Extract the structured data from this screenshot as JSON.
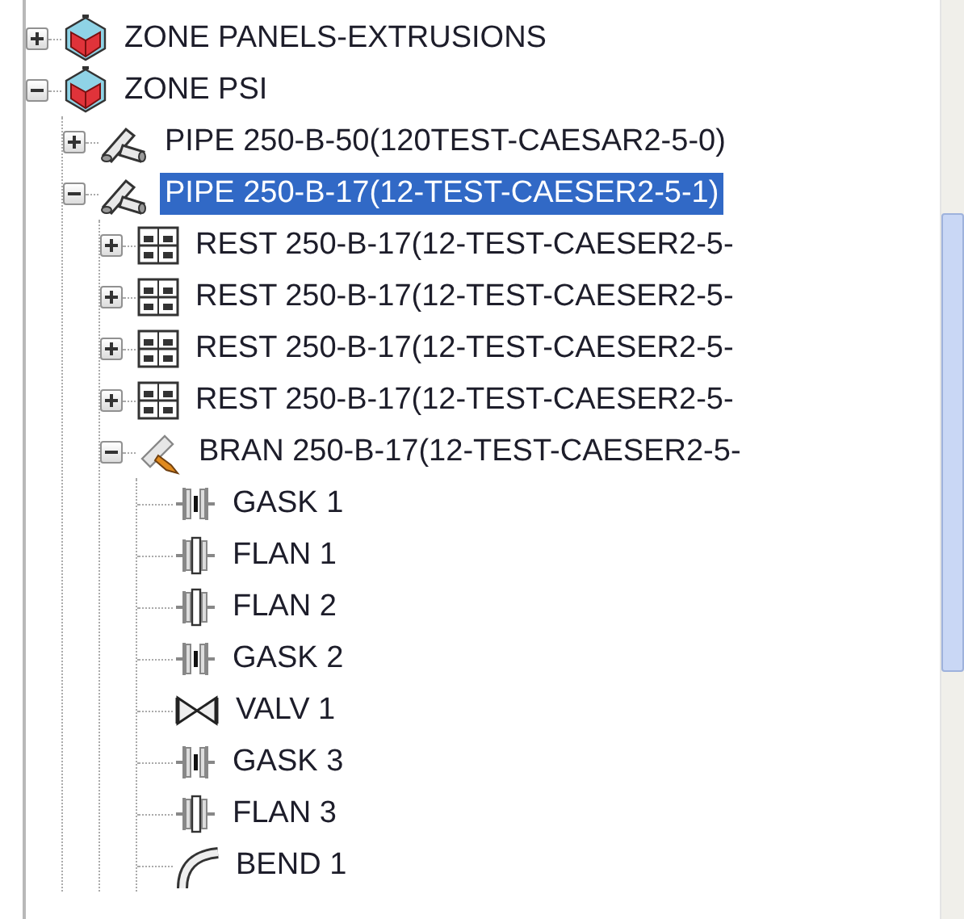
{
  "tree": [
    {
      "kind": "zone",
      "label": "ZONE PANELS-EXTRUSIONS",
      "expanded": false,
      "selected": false
    },
    {
      "kind": "zone",
      "label": "ZONE PSI",
      "expanded": true,
      "selected": false,
      "children": [
        {
          "kind": "pipe",
          "label": "PIPE 250-B-50(120TEST-CAESAR2-5-0)",
          "expanded": false,
          "selected": false
        },
        {
          "kind": "pipe",
          "label": "PIPE 250-B-17(12-TEST-CAESER2-5-1)",
          "expanded": true,
          "selected": true,
          "children": [
            {
              "kind": "rest",
              "label": "REST 250-B-17(12-TEST-CAESER2-5-",
              "expanded": false,
              "selected": false
            },
            {
              "kind": "rest",
              "label": "REST 250-B-17(12-TEST-CAESER2-5-",
              "expanded": false,
              "selected": false
            },
            {
              "kind": "rest",
              "label": "REST 250-B-17(12-TEST-CAESER2-5-",
              "expanded": false,
              "selected": false
            },
            {
              "kind": "rest",
              "label": "REST 250-B-17(12-TEST-CAESER2-5-",
              "expanded": false,
              "selected": false
            },
            {
              "kind": "bran",
              "label": "BRAN 250-B-17(12-TEST-CAESER2-5-",
              "expanded": true,
              "selected": false,
              "children": [
                {
                  "kind": "gask",
                  "label": "GASK 1",
                  "selected": false
                },
                {
                  "kind": "flan",
                  "label": "FLAN 1",
                  "selected": false
                },
                {
                  "kind": "flan",
                  "label": "FLAN 2",
                  "selected": false
                },
                {
                  "kind": "gask",
                  "label": "GASK 2",
                  "selected": false
                },
                {
                  "kind": "valv",
                  "label": "VALV 1",
                  "selected": false
                },
                {
                  "kind": "gask",
                  "label": "GASK 3",
                  "selected": false
                },
                {
                  "kind": "flan",
                  "label": "FLAN 3",
                  "selected": false
                },
                {
                  "kind": "bend",
                  "label": "BEND 1",
                  "selected": false
                }
              ]
            }
          ]
        }
      ]
    }
  ]
}
